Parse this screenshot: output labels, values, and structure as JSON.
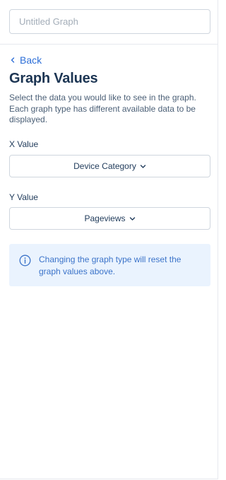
{
  "graph_title": {
    "placeholder": "Untitled Graph",
    "value": ""
  },
  "nav": {
    "back_label": "Back"
  },
  "section": {
    "heading": "Graph Values",
    "description": "Select the data you would like to see in the graph. Each graph type has different available data to be displayed."
  },
  "x_value": {
    "label": "X Value",
    "selected": "Device Category"
  },
  "y_value": {
    "label": "Y Value",
    "selected": "Pageviews"
  },
  "notice": {
    "icon": "info-icon",
    "text": "Changing the graph type will reset the graph values above."
  },
  "colors": {
    "accent": "#2d6fd8",
    "heading": "#1c3553",
    "info_bg": "#eaf3fe",
    "info_text": "#3b73c9"
  }
}
